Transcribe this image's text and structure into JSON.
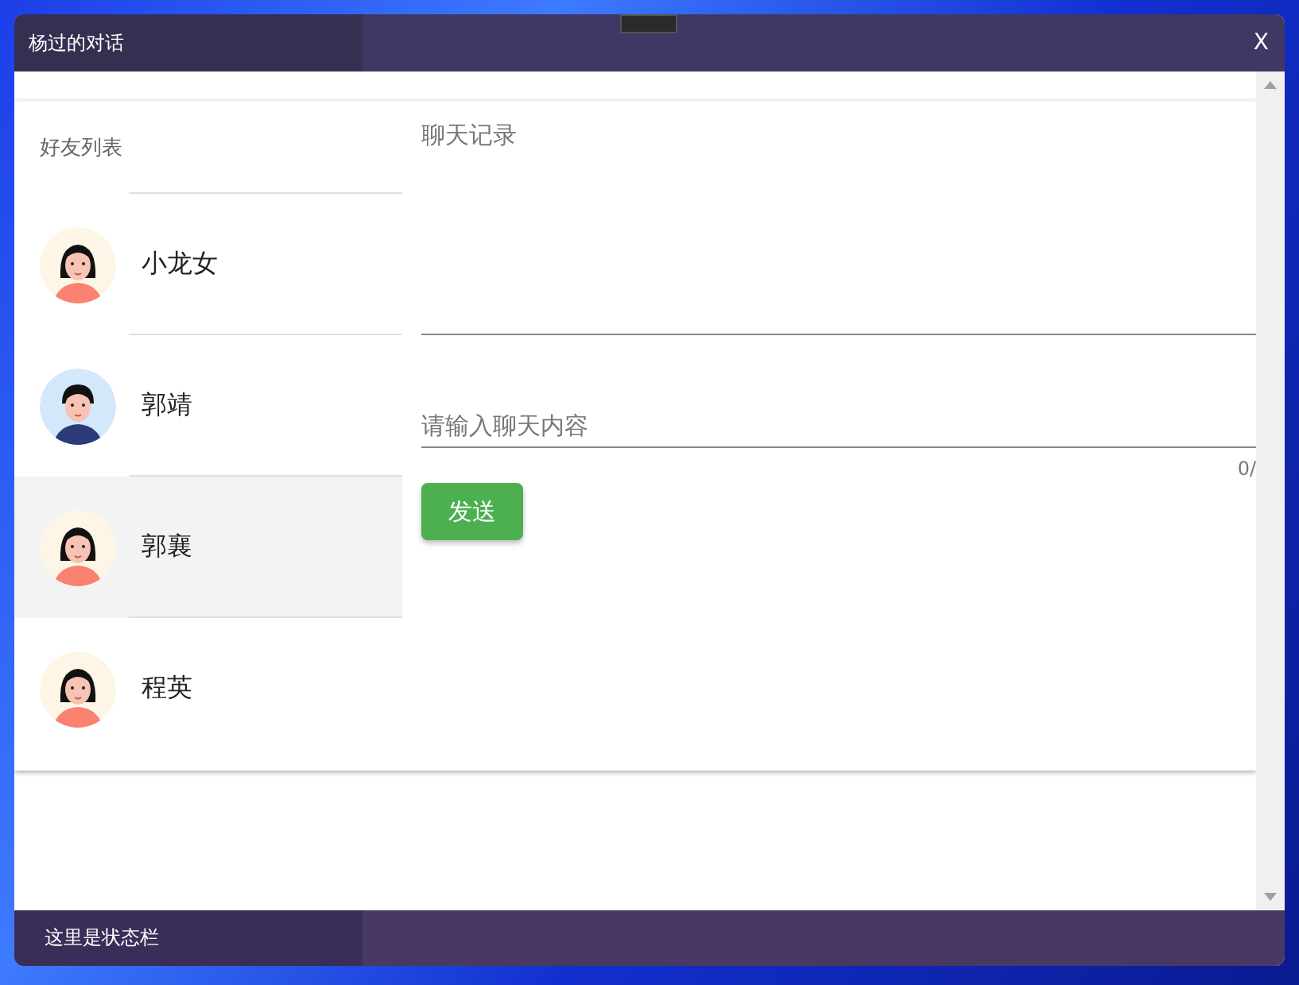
{
  "window": {
    "title": "杨过的对话",
    "close": "X"
  },
  "friends": {
    "title": "好友列表",
    "items": [
      {
        "name": "小龙女",
        "kind": "female",
        "selected": false
      },
      {
        "name": "郭靖",
        "kind": "male",
        "selected": false
      },
      {
        "name": "郭襄",
        "kind": "female",
        "selected": true
      },
      {
        "name": "程英",
        "kind": "female",
        "selected": false
      }
    ]
  },
  "chat": {
    "record_placeholder": "聊天记录",
    "input_placeholder": "请输入聊天内容",
    "counter": "0/",
    "send": "发送"
  },
  "status_bar": "这里是状态栏"
}
